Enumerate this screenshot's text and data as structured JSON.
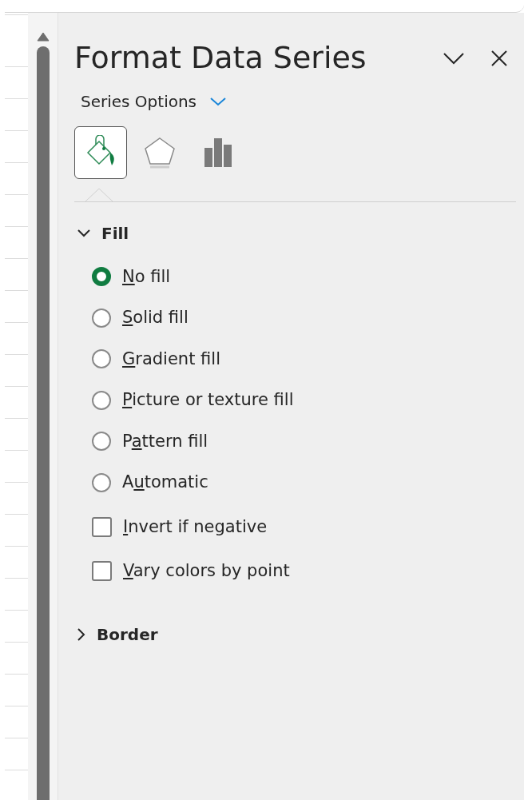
{
  "pane": {
    "title": "Format Data Series",
    "options_menu": "Series Options"
  },
  "tabs": [
    {
      "kind": "fill",
      "selected": true
    },
    {
      "kind": "effects",
      "selected": false
    },
    {
      "kind": "series",
      "selected": false
    }
  ],
  "sections": [
    {
      "title": "Fill",
      "expanded": true,
      "options": [
        {
          "kind": "radio",
          "access_key": "N",
          "label_end": "o fill",
          "selected": true
        },
        {
          "kind": "radio",
          "access_key": "S",
          "label_end": "olid fill",
          "selected": false
        },
        {
          "kind": "radio",
          "access_key": "G",
          "label_end": "radient fill",
          "selected": false
        },
        {
          "kind": "radio",
          "access_key": "P",
          "label_end": "icture or texture fill",
          "selected": false
        },
        {
          "kind": "radio",
          "label_start": "P",
          "access_key": "a",
          "label_end": "ttern fill",
          "selected": false
        },
        {
          "kind": "radio",
          "label_start": "A",
          "access_key": "u",
          "label_end": "tomatic",
          "selected": false
        },
        {
          "kind": "checkbox",
          "access_key": "I",
          "label_end": "nvert if negative",
          "checked": false
        },
        {
          "kind": "checkbox",
          "access_key": "V",
          "label_end": "ary colors by point",
          "checked": false
        }
      ]
    },
    {
      "title": "Border",
      "expanded": false
    }
  ]
}
